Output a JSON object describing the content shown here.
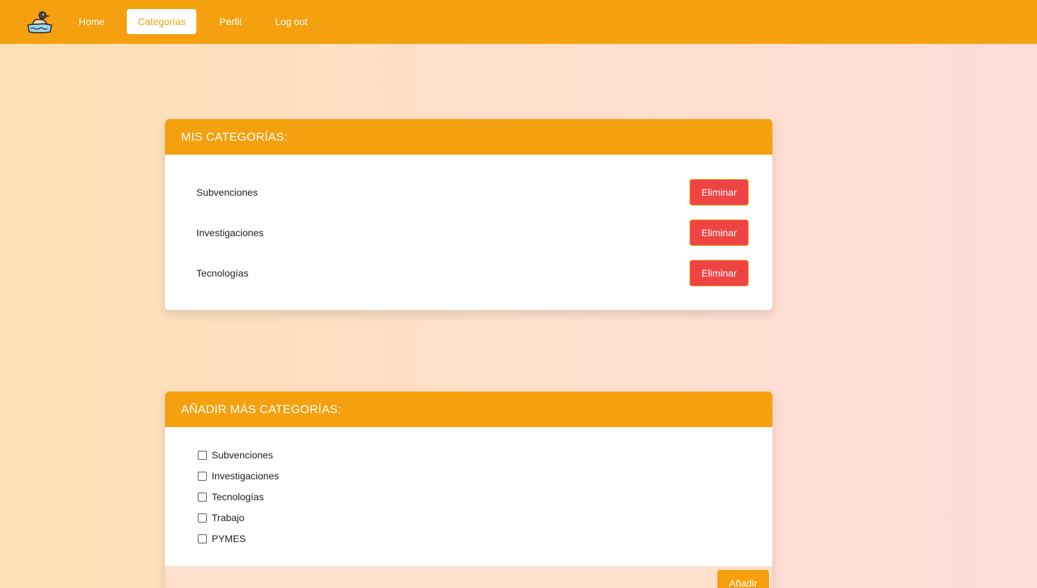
{
  "navbar": {
    "logo_icon": "duck-logo-icon",
    "links": [
      {
        "label": "Home"
      },
      {
        "label": "Categorías",
        "active": true
      },
      {
        "label": "Perfil"
      },
      {
        "label": "Log out"
      }
    ],
    "color": "#f4a00f"
  },
  "my_categories": {
    "title": "MIS CATEGORÍAS:",
    "items": [
      {
        "name": "Subvenciones",
        "action": "Eliminar"
      },
      {
        "name": "Investigaciones",
        "action": "Eliminar"
      },
      {
        "name": "Tecnologías",
        "action": "Eliminar"
      }
    ],
    "delete_color": "#ef4444"
  },
  "add_categories": {
    "title": "AÑADIR MÁS CATEGORÍAS:",
    "options": [
      {
        "label": "Subvenciones",
        "checked": false
      },
      {
        "label": "Investigaciones",
        "checked": false
      },
      {
        "label": "Tecnologías",
        "checked": false
      },
      {
        "label": "Trabajo",
        "checked": false
      },
      {
        "label": "PYMES",
        "checked": false
      }
    ],
    "submit_label": "Añadir"
  }
}
